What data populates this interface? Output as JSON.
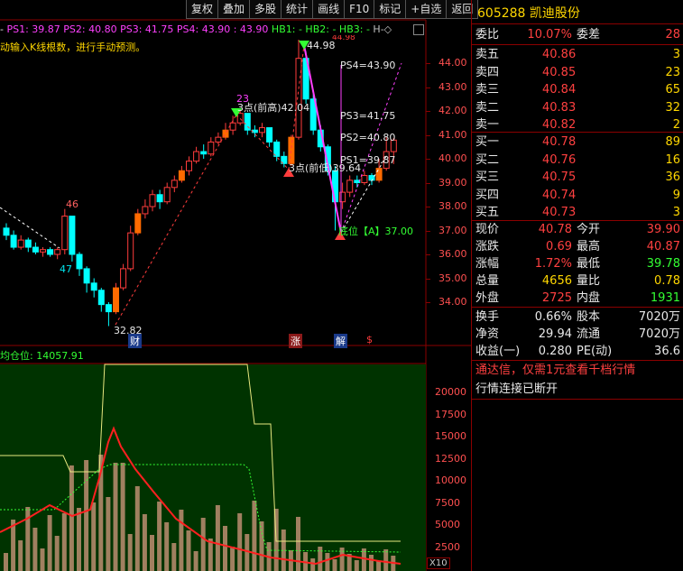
{
  "toolbar": [
    "复权",
    "叠加",
    "多股",
    "统计",
    "画线",
    "F10",
    "标记",
    "+自选",
    "返回"
  ],
  "indicator_line": {
    "prefix": "- ",
    "items": [
      {
        "text": "PS1: 39.87",
        "color": "#ff40ff"
      },
      {
        "text": "PS2: 40.80",
        "color": "#ff40ff"
      },
      {
        "text": "PS3: 41.75",
        "color": "#ff40ff"
      },
      {
        "text": "PS4: 43.90",
        "color": "#ff40ff"
      },
      {
        "text": ": 43.90",
        "color": "#ff40ff"
      },
      {
        "text": "HB1: -",
        "color": "#33ff33"
      },
      {
        "text": "HB2: -",
        "color": "#33ff33"
      },
      {
        "text": "HB3: -",
        "color": "#33ff33"
      },
      {
        "text": "H-◇",
        "color": "#c0c0c0"
      }
    ],
    "note": "动输入K线根数，进行手动预测。"
  },
  "price_axis": [
    "44.00",
    "43.00",
    "42.00",
    "41.00",
    "40.00",
    "39.00",
    "38.00",
    "37.00",
    "36.00",
    "35.00",
    "34.00"
  ],
  "chart_labels": {
    "high_46": "46",
    "low_47": "47",
    "hi_23": "23",
    "prev_high": "3点(前高)42.04",
    "peak": "44.98",
    "peak_hidden": "44.98",
    "prev_low": "3点(前低)39.64",
    "ps4": "PS4=43.90",
    "ps3": "PS3=41.75",
    "ps2": "PS2=40.80",
    "ps1": "PS1=39.87",
    "bottom": "底位【A】37.00",
    "low": "32.82",
    "cai": "财",
    "zhang": "涨",
    "jie": "解",
    "s": "$"
  },
  "sub_indicator": {
    "title": "均仓位: 14057.91"
  },
  "volume_axis": [
    "20000",
    "17500",
    "15000",
    "12500",
    "10000",
    "7500",
    "5000",
    "2500"
  ],
  "volume_unit": "X10",
  "stock": {
    "code": "605288",
    "name": "凯迪股份"
  },
  "ratio_row": {
    "l1": "委比",
    "v1": "10.07%",
    "l2": "委差",
    "v2": "28"
  },
  "asks": [
    {
      "label": "卖五",
      "price": "40.86",
      "vol": "3"
    },
    {
      "label": "卖四",
      "price": "40.85",
      "vol": "23"
    },
    {
      "label": "卖三",
      "price": "40.84",
      "vol": "65"
    },
    {
      "label": "卖二",
      "price": "40.83",
      "vol": "32"
    },
    {
      "label": "卖一",
      "price": "40.82",
      "vol": "2"
    }
  ],
  "bids": [
    {
      "label": "买一",
      "price": "40.78",
      "vol": "89"
    },
    {
      "label": "买二",
      "price": "40.76",
      "vol": "16"
    },
    {
      "label": "买三",
      "price": "40.75",
      "vol": "36"
    },
    {
      "label": "买四",
      "price": "40.74",
      "vol": "9"
    },
    {
      "label": "买五",
      "price": "40.73",
      "vol": "3"
    }
  ],
  "quote": [
    {
      "l1": "现价",
      "v1": "40.78",
      "c1": "red",
      "l2": "今开",
      "v2": "39.90",
      "c2": "red"
    },
    {
      "l1": "涨跌",
      "v1": "0.69",
      "c1": "red",
      "l2": "最高",
      "v2": "40.87",
      "c2": "red"
    },
    {
      "l1": "涨幅",
      "v1": "1.72%",
      "c1": "red",
      "l2": "最低",
      "v2": "39.78",
      "c2": "grn"
    },
    {
      "l1": "总量",
      "v1": "4656",
      "c1": "yel",
      "l2": "量比",
      "v2": "0.78",
      "c2": "yel"
    },
    {
      "l1": "外盘",
      "v1": "2725",
      "c1": "red",
      "l2": "内盘",
      "v2": "1931",
      "c2": "grn"
    }
  ],
  "fund": [
    {
      "l1": "换手",
      "v1": "0.66%",
      "l2": "股本",
      "v2": "7020万"
    },
    {
      "l1": "净资",
      "v1": "29.94",
      "l2": "流通",
      "v2": "7020万"
    },
    {
      "l1": "收益(一)",
      "v1": "0.280",
      "l2": "PE(动)",
      "v2": "36.6"
    }
  ],
  "notice": "通达信，仅需1元查看千档行情",
  "status": "行情连接已断开",
  "colors": {
    "up": "#ff3c3c",
    "down": "#00ffff",
    "accent": "#ffd700",
    "border": "#8b0000"
  }
}
